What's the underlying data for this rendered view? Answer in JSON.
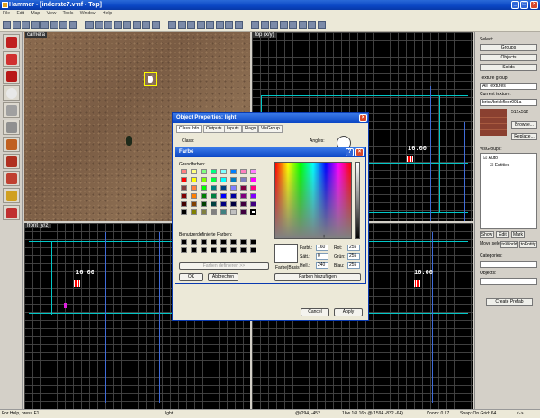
{
  "window": {
    "title": "Hammer - [indcrate7.vmf - Top]"
  },
  "menu": [
    "File",
    "Edit",
    "Map",
    "View",
    "Tools",
    "Window",
    "Help"
  ],
  "views": {
    "camera": "camera",
    "top": "top (x/y)",
    "front": "front (y/z)",
    "side_label": "16.00"
  },
  "labels": {
    "top_value": "16.00",
    "front_value": "16.00"
  },
  "right_panel": {
    "select_label": "Select:",
    "groups": "Groups",
    "objects": "Objects",
    "solids": "Solids",
    "texture_group_label": "Texture group:",
    "texture_group_value": "All Textures",
    "current_texture_label": "Current texture:",
    "current_texture_value": "brick/brickfloor001a",
    "texture_size": "512x512",
    "browse": "Browse...",
    "replace": "Replace...",
    "visgroups_label": "VisGroups:",
    "auto": "Auto",
    "entities": "Entities",
    "show": "Show",
    "edit": "Edit",
    "mark": "Mark",
    "move_selected": "Move selected:",
    "to_world": "toWorld",
    "to_entity": "toEntity",
    "categories_label": "Categories:",
    "objects_label": "Objects:",
    "create_prefab": "Create Prefab"
  },
  "statusbar": {
    "help": "For Help, press F1",
    "object": "light",
    "coords": "@(294, -452",
    "size": "16w 16l 16h @(1594 -832 -64)",
    "zoom": "Zoom: 0.17",
    "snap": "Snap: On Grid: 64",
    "extra": "<->"
  },
  "object_dialog": {
    "title": "Object Properties: light",
    "tabs": [
      "Class Info",
      "Outputs",
      "Inputs",
      "Flags",
      "VisGroup"
    ],
    "class_label": "Class:",
    "angles_label": "Angles:",
    "cancel": "Cancel",
    "apply": "Apply"
  },
  "color_dialog": {
    "title": "Farbe",
    "help": "?",
    "basic_colors": "Grundfarben:",
    "custom_colors": "Benutzerdefinierte Farben:",
    "define_custom": "Farben definieren >>",
    "ok": "OK",
    "cancel": "Abbrechen",
    "color_solid": "Farbe|Basis",
    "hue_label": "Farbt.:",
    "hue": "160",
    "sat_label": "Sätt.:",
    "sat": "0",
    "lum_label": "Hell.:",
    "lum": "240",
    "red_label": "Rot:",
    "red": "255",
    "green_label": "Grün:",
    "green": "255",
    "blue_label": "Blau:",
    "blue": "255",
    "add_custom": "Farben hinzufügen",
    "basic_palette": [
      "#ff8080",
      "#ffff80",
      "#80ff80",
      "#00ff80",
      "#80ffff",
      "#0080ff",
      "#ff80c0",
      "#ff80ff",
      "#ff0000",
      "#ffff00",
      "#80ff00",
      "#00ff40",
      "#00ffff",
      "#0080c0",
      "#8080c0",
      "#ff00ff",
      "#804040",
      "#ff8040",
      "#00ff00",
      "#008080",
      "#004080",
      "#8080ff",
      "#800040",
      "#ff0080",
      "#800000",
      "#ff8000",
      "#008000",
      "#008040",
      "#0000ff",
      "#0000a0",
      "#800080",
      "#8000ff",
      "#400000",
      "#804000",
      "#004000",
      "#004040",
      "#000080",
      "#000040",
      "#400040",
      "#400080",
      "#000000",
      "#808000",
      "#808040",
      "#808080",
      "#408080",
      "#c0c0c0",
      "#400040",
      "#ffffff"
    ]
  }
}
